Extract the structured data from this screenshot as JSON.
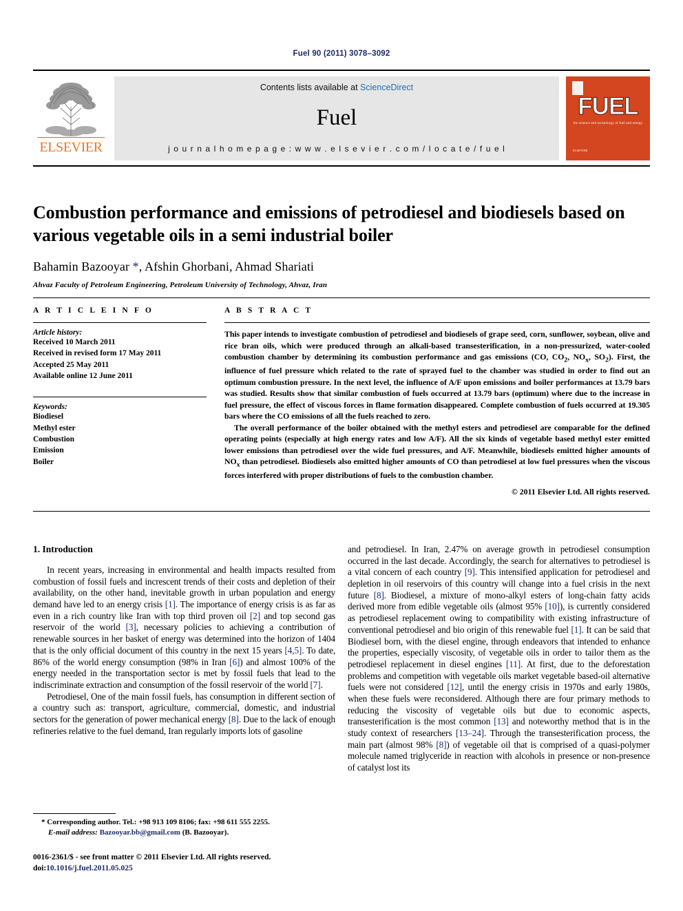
{
  "running_head": "Fuel 90 (2011) 3078–3092",
  "masthead": {
    "publisher_name": "ELSEVIER",
    "contents_prefix": "Contents lists available at ",
    "contents_link": "ScienceDirect",
    "journal_title": "Fuel",
    "homepage": "j o u r n a l   h o m e p a g e :   w w w . e l s e v i e r . c o m / l o c a t e / f u e l",
    "cover": {
      "title": "FUEL",
      "subtitle": "the science and technology of fuel and energy",
      "footer": "ELSEVIER"
    }
  },
  "article": {
    "title": "Combustion performance and emissions of petrodiesel and biodiesels based on various vegetable oils in a semi industrial boiler",
    "authors": "Bahamin Bazooyar , Afshin Ghorbani, Ahmad Shariati",
    "corresponding_marker": "*",
    "affiliation": "Ahvaz Faculty of Petroleum Engineering, Petroleum University of Technology, Ahvaz, Iran"
  },
  "article_info": {
    "heading": "A R T I C L E   I N F O",
    "history_label": "Article history:",
    "history": [
      "Received 10 March 2011",
      "Received in revised form 17 May 2011",
      "Accepted 25 May 2011",
      "Available online 12 June 2011"
    ],
    "keywords_label": "Keywords:",
    "keywords": [
      "Biodiesel",
      "Methyl ester",
      "Combustion",
      "Emission",
      "Boiler"
    ]
  },
  "abstract": {
    "heading": "A B S T R A C T",
    "paragraphs": [
      "This paper intends to investigate combustion of petrodiesel and biodiesels of grape seed, corn, sunflower, soybean, olive and rice bran oils, which were produced through an alkali-based transesterification, in a non-pressurized, water-cooled combustion chamber by determining its combustion performance and gas emissions (CO, CO2, NOx, SO2). First, the influence of fuel pressure which related to the rate of sprayed fuel to the chamber was studied in order to find out an optimum combustion pressure. In the next level, the influence of A/F upon emissions and boiler performances at 13.79 bars was studied. Results show that similar combustion of fuels occurred at 13.79 bars (optimum) where due to the increase in fuel pressure, the effect of viscous forces in flame formation disappeared. Complete combustion of fuels occurred at 19.305 bars where the CO emissions of all the fuels reached to zero.",
      "The overall performance of the boiler obtained with the methyl esters and petrodiesel are comparable for the defined operating points (especially at high energy rates and low A/F). All the six kinds of vegetable based methyl ester emitted lower emissions than petrodiesel over the wide fuel pressures, and A/F. Meanwhile, biodiesels emitted higher amounts of NOx than petrodiesel. Biodiesels also emitted higher amounts of CO than petrodiesel at low fuel pressures when the viscous forces interfered with proper distributions of fuels to the combustion chamber."
    ],
    "copyright": "© 2011 Elsevier Ltd. All rights reserved."
  },
  "introduction": {
    "heading": "1. Introduction",
    "left_paragraphs": [
      "In recent years, increasing in environmental and health impacts resulted from combustion of fossil fuels and increscent trends of their costs and depletion of their availability, on the other hand, inevitable growth in urban population and energy demand have led to an energy crisis [1]. The importance of energy crisis is as far as even in a rich country like Iran with top third proven oil [2] and top second gas reservoir of the world [3], necessary policies to achieving a contribution of renewable sources in her basket of energy was determined into the horizon of 1404 that is the only official document of this country in the next 15 years [4,5]. To date, 86% of the world energy consumption (98% in Iran [6]) and almost 100% of the energy needed in the transportation sector is met by fossil fuels that lead to the indiscriminate extraction and consumption of the fossil reservoir of the world [7].",
      "Petrodiesel, One of the main fossil fuels, has consumption in different section of a country such as: transport, agriculture, commercial, domestic, and industrial sectors for the generation of power mechanical energy [8]. Due to the lack of enough refineries relative to the fuel demand, Iran regularly imports lots of gasoline"
    ],
    "right_paragraphs": [
      "and petrodiesel. In Iran, 2.47% on average growth in petrodiesel consumption occurred in the last decade. Accordingly, the search for alternatives to petrodiesel is a vital concern of each country [9]. This intensified application for petrodiesel and depletion in oil reservoirs of this country will change into a fuel crisis in the next future [8]. Biodiesel, a mixture of mono-alkyl esters of long-chain fatty acids derived more from edible vegetable oils (almost 95% [10]), is currently considered as petrodiesel replacement owing to compatibility with existing infrastructure of conventional petrodiesel and bio origin of this renewable fuel [1]. It can be said that Biodiesel born, with the diesel engine, through endeavors that intended to enhance the properties, especially viscosity, of vegetable oils in order to tailor them as the petrodiesel replacement in diesel engines [11]. At first, due to the deforestation problems and competition with vegetable oils market vegetable based-oil alternative fuels were not considered [12], until the energy crisis in 1970s and early 1980s, when these fuels were reconsidered. Although there are four primary methods to reducing the viscosity of vegetable oils but due to economic aspects, transesterification is the most common [13] and noteworthy method that is in the study context of researchers [13–24]. Through the transesterification process, the main part (almost 98% [8]) of vegetable oil that is comprised of a quasi-polymer molecule named triglyceride in reaction with alcohols in presence or non-presence of catalyst lost its"
    ]
  },
  "footnote": {
    "marker": "*",
    "corresponding": "Corresponding author. Tel.: +98 913 109 8106; fax: +98 611 555 2255.",
    "email_label": "E-mail address:",
    "email": "Bazooyar.bb@gmail.com",
    "email_owner": "(B. Bazooyar)."
  },
  "imprint": {
    "line1": "0016-2361/$ - see front matter © 2011 Elsevier Ltd. All rights reserved.",
    "doi_label": "doi:",
    "doi_value": "10.1016/j.fuel.2011.05.025"
  }
}
